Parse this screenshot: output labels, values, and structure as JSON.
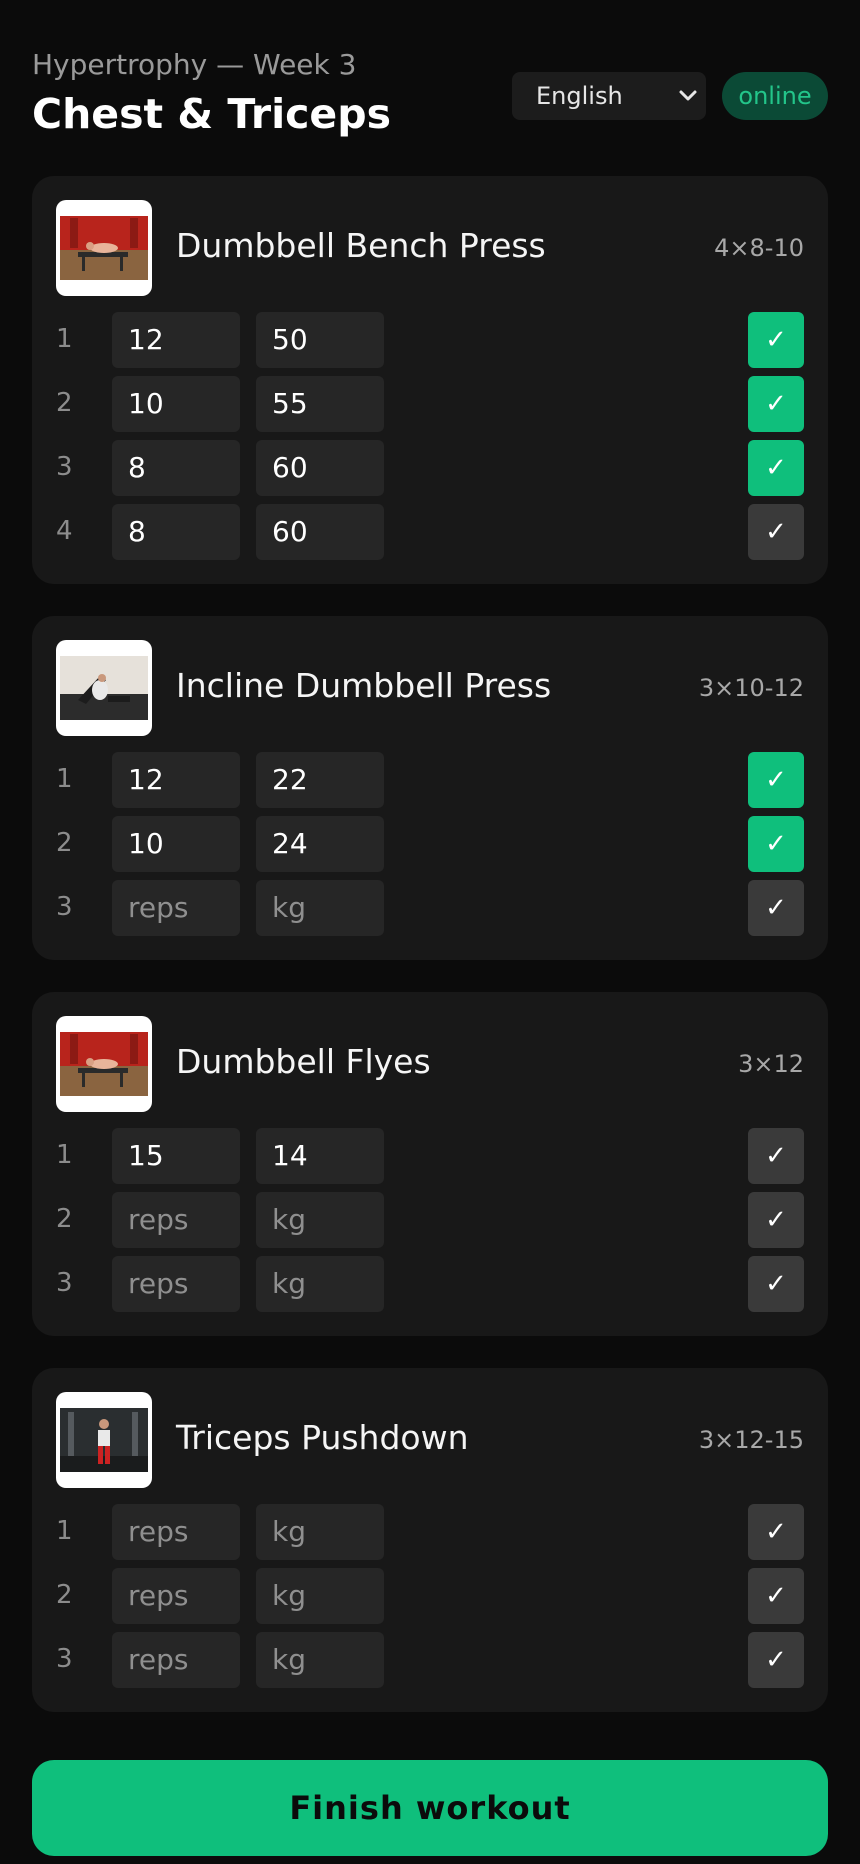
{
  "header": {
    "subtitle": "Hypertrophy — Week 3",
    "title": "Chest & Triceps",
    "language": "English",
    "status": "online"
  },
  "colors": {
    "accent": "#0fbf7c",
    "check_pending": "#3a3a3a",
    "card_bg": "#181818",
    "page_bg": "#0b0b0b"
  },
  "exercises": [
    {
      "name": "Dumbbell Bench Press",
      "scheme": "4×8-10",
      "sets": [
        {
          "num": "1",
          "reps": "12",
          "kg": "50",
          "done": true
        },
        {
          "num": "2",
          "reps": "10",
          "kg": "55",
          "done": true
        },
        {
          "num": "3",
          "reps": "8",
          "kg": "60",
          "done": true
        },
        {
          "num": "4",
          "reps": "8",
          "kg": "60",
          "done": false
        }
      ]
    },
    {
      "name": "Incline Dumbbell Press",
      "scheme": "3×10-12",
      "sets": [
        {
          "num": "1",
          "reps": "12",
          "kg": "22",
          "done": true
        },
        {
          "num": "2",
          "reps": "10",
          "kg": "24",
          "done": true
        },
        {
          "num": "3",
          "reps": "",
          "kg": "",
          "done": false
        }
      ]
    },
    {
      "name": "Dumbbell Flyes",
      "scheme": "3×12",
      "sets": [
        {
          "num": "1",
          "reps": "15",
          "kg": "14",
          "done": false
        },
        {
          "num": "2",
          "reps": "",
          "kg": "",
          "done": false
        },
        {
          "num": "3",
          "reps": "",
          "kg": "",
          "done": false
        }
      ]
    },
    {
      "name": "Triceps Pushdown",
      "scheme": "3×12-15",
      "sets": [
        {
          "num": "1",
          "reps": "",
          "kg": "",
          "done": false
        },
        {
          "num": "2",
          "reps": "",
          "kg": "",
          "done": false
        },
        {
          "num": "3",
          "reps": "",
          "kg": "",
          "done": false
        }
      ]
    }
  ],
  "placeholders": {
    "reps": "reps",
    "kg": "kg"
  },
  "check_glyph": "✓",
  "finish_label": "Finish workout"
}
